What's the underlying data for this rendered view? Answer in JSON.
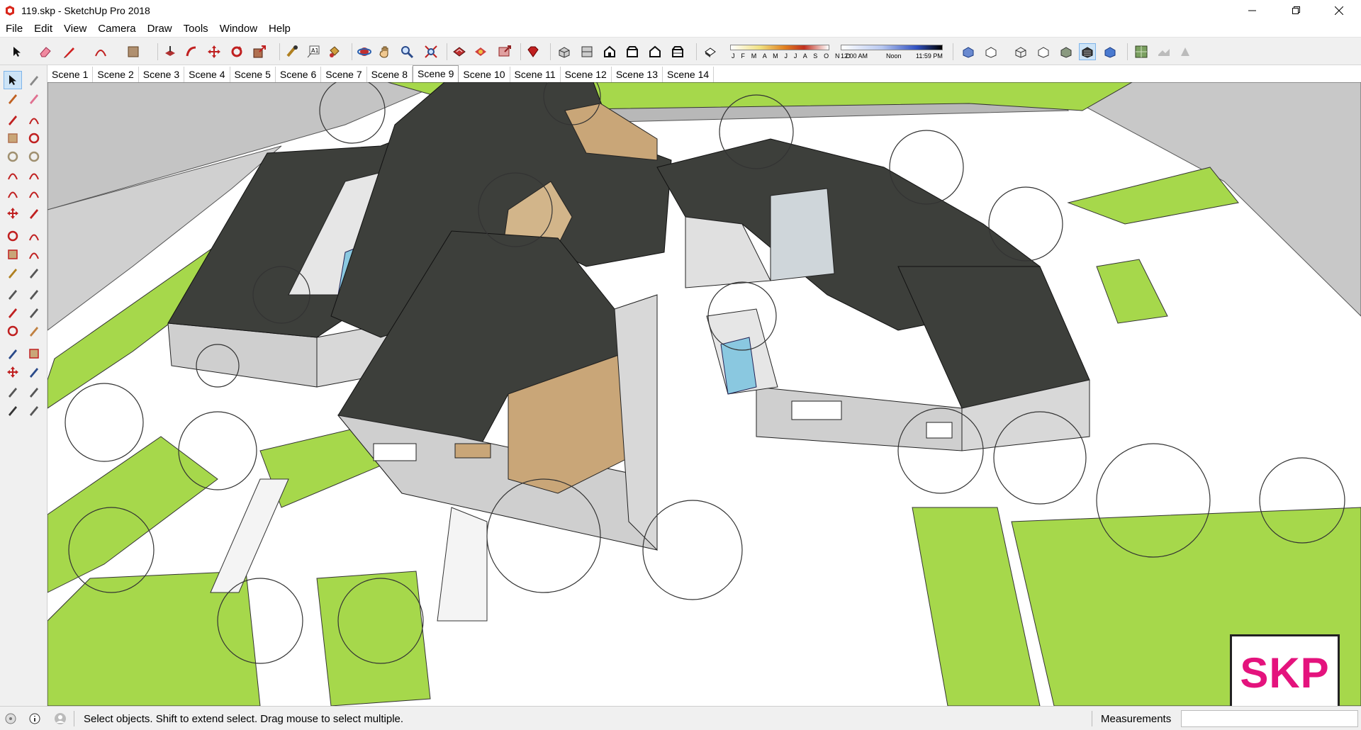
{
  "window": {
    "title": "119.skp - SketchUp Pro 2018",
    "controls": [
      "minimize-icon",
      "restore-icon",
      "close-icon"
    ]
  },
  "menu": [
    "File",
    "Edit",
    "View",
    "Camera",
    "Draw",
    "Tools",
    "Window",
    "Help"
  ],
  "shadows": {
    "months_label": "J F M A M J J A S O N D",
    "time_start": "12:00 AM",
    "time_mid": "Noon",
    "time_end": "11:59 PM"
  },
  "scenes": {
    "tabs": [
      "Scene 1",
      "Scene 2",
      "Scene 3",
      "Scene 4",
      "Scene 5",
      "Scene 6",
      "Scene 7",
      "Scene 8",
      "Scene 9",
      "Scene 10",
      "Scene 11",
      "Scene 12",
      "Scene 13",
      "Scene 14"
    ],
    "active": "Scene 9"
  },
  "status": {
    "hint": "Select objects. Shift to extend select. Drag mouse to select multiple.",
    "measurements_label": "Measurements",
    "measurements_value": ""
  },
  "watermark": {
    "text": "SKP",
    "color": "#e4137d"
  },
  "colors": {
    "roof": "#3d3f3b",
    "grass": "#a6d84b",
    "wall": "#cfcfcf",
    "wood": "#c9a678",
    "water": "#8ac8e0",
    "selection": "#cde4f7"
  },
  "left_tools": [
    "select-icon",
    "component-icon",
    "paint-bucket-icon",
    "eraser-icon",
    "line-icon",
    "freehand-icon",
    "rectangle-icon",
    "rotated-rectangle-icon",
    "circle-icon",
    "polygon-icon",
    "arc-icon",
    "pie-icon",
    "two-point-arc-icon",
    "three-point-arc-icon",
    "move-icon",
    "push-pull-icon",
    "rotate-icon",
    "follow-me-icon",
    "scale-icon",
    "offset-icon",
    "tape-measure-icon",
    "dimension-icon",
    "protractor-icon",
    "text-icon",
    "axes-icon",
    "3d-text-icon",
    "orbit-icon",
    "pan-icon",
    "zoom-icon",
    "zoom-window-icon",
    "zoom-extents-icon",
    "previous-view-icon",
    "position-camera-icon",
    "look-around-icon",
    "walk-icon",
    "section-plane-icon"
  ]
}
